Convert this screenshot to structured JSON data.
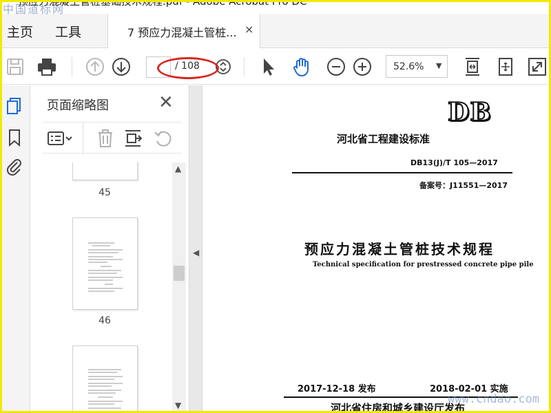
{
  "watermark_top": "中国道标网",
  "watermark_bottom": "www.cndao.com",
  "window": {
    "title": "预应力混凝土管桩基础技术规程.pdf - Adobe Acrobat Pro DC"
  },
  "tabs": {
    "home": "主页",
    "tools": "工具",
    "document": "7 预应力混凝土管桩...",
    "close_glyph": "×"
  },
  "toolbar": {
    "page_current": "",
    "page_total": "/ 108",
    "zoom": "52.6%",
    "zoom_caret": "▼",
    "icons": [
      "save-icon",
      "print-icon",
      "prev-page-icon",
      "next-page-icon",
      "page-stepper-icon",
      "select-cursor-icon",
      "hand-tool-icon",
      "zoom-out-icon",
      "zoom-in-icon",
      "fit-page-icon",
      "rotate-page-icon",
      "full-screen-icon"
    ],
    "annotation_color": "#d42a22"
  },
  "leftrail": {
    "icons": [
      "page-thumbnails-icon",
      "bookmarks-icon",
      "attachments-icon"
    ],
    "accent": "#1e6bd6"
  },
  "thumbnail_panel": {
    "title": "页面缩略图",
    "close_glyph": "✕",
    "tools": [
      "thumbnail-options-icon",
      "delete-page-icon",
      "extract-pages-icon",
      "rotate-page-icon"
    ],
    "pages": [
      {
        "number": "45"
      },
      {
        "number": "46"
      },
      {
        "number": ""
      }
    ]
  },
  "document": {
    "badge": "DB",
    "standard_title": "河北省工程建设标准",
    "standard_code": "DB13(J)/T 105—2017",
    "record_no": "备案号：J11551—2017",
    "main_title": "预应力混凝土管桩技术规程",
    "main_title_en": "Technical specification for prestressed concrete pipe pile",
    "publish_date": "2017-12-18 发布",
    "effective_date": "2018-02-01 实施",
    "issuer": "河北省住房和城乡建设厅发布"
  }
}
